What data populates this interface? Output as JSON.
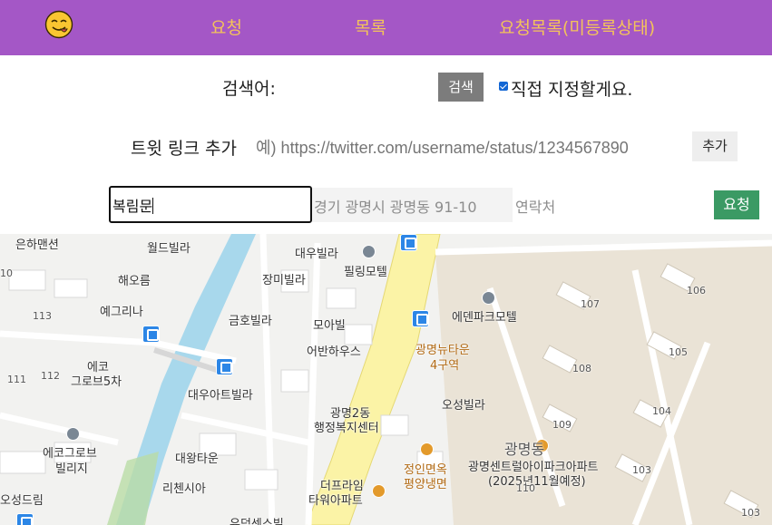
{
  "nav": {
    "logo_icon": "smiling-face-with-tongue-icon",
    "links": [
      "요청",
      "목록",
      "요청목록(미등록상태)"
    ]
  },
  "search": {
    "label": "검색어:",
    "button": "검색",
    "checkbox_checked": true,
    "checkbox_label": "직접 지정할게요."
  },
  "tweet": {
    "label": "트윗 링크 추가",
    "placeholder": "예) https://twitter.com/username/status/1234567890",
    "button": "추가"
  },
  "request": {
    "name_value": "복림문",
    "address_value": "경기 광명시 광명동 91-10",
    "phone_placeholder": "연락처",
    "button": "요청"
  },
  "map": {
    "labels": [
      "은하맨션",
      "월드빌라",
      "대우빌라",
      "필링모텔",
      "해오름",
      "장미빌라",
      "예그리나",
      "금호빌라",
      "모아빌",
      "에덴파크모텔",
      "어반하우스",
      "광명뉴타운",
      "4구역",
      "에코",
      "그로브5차",
      "대우아트빌라",
      "오성빌라",
      "광명2동",
      "행정복지센터",
      "에코그로브",
      "빌리지",
      "대왕타운",
      "리첸시아",
      "정인면옥",
      "평양냉면",
      "더프라임",
      "타워아파트",
      "오성드림",
      "광명동",
      "광명센트럴아이파크아파트",
      "(2025년11월예정)",
      "유덕센스빌"
    ],
    "building_numbers": [
      "10",
      "113",
      "111",
      "112",
      "107",
      "106",
      "105",
      "108",
      "104",
      "109",
      "103",
      "110",
      "103"
    ],
    "colors": {
      "road": "#fbf3a6",
      "river": "#a8d8ec",
      "land": "#eae4d8",
      "nav": "#a457c6",
      "nav_text": "#f4c35a"
    }
  }
}
